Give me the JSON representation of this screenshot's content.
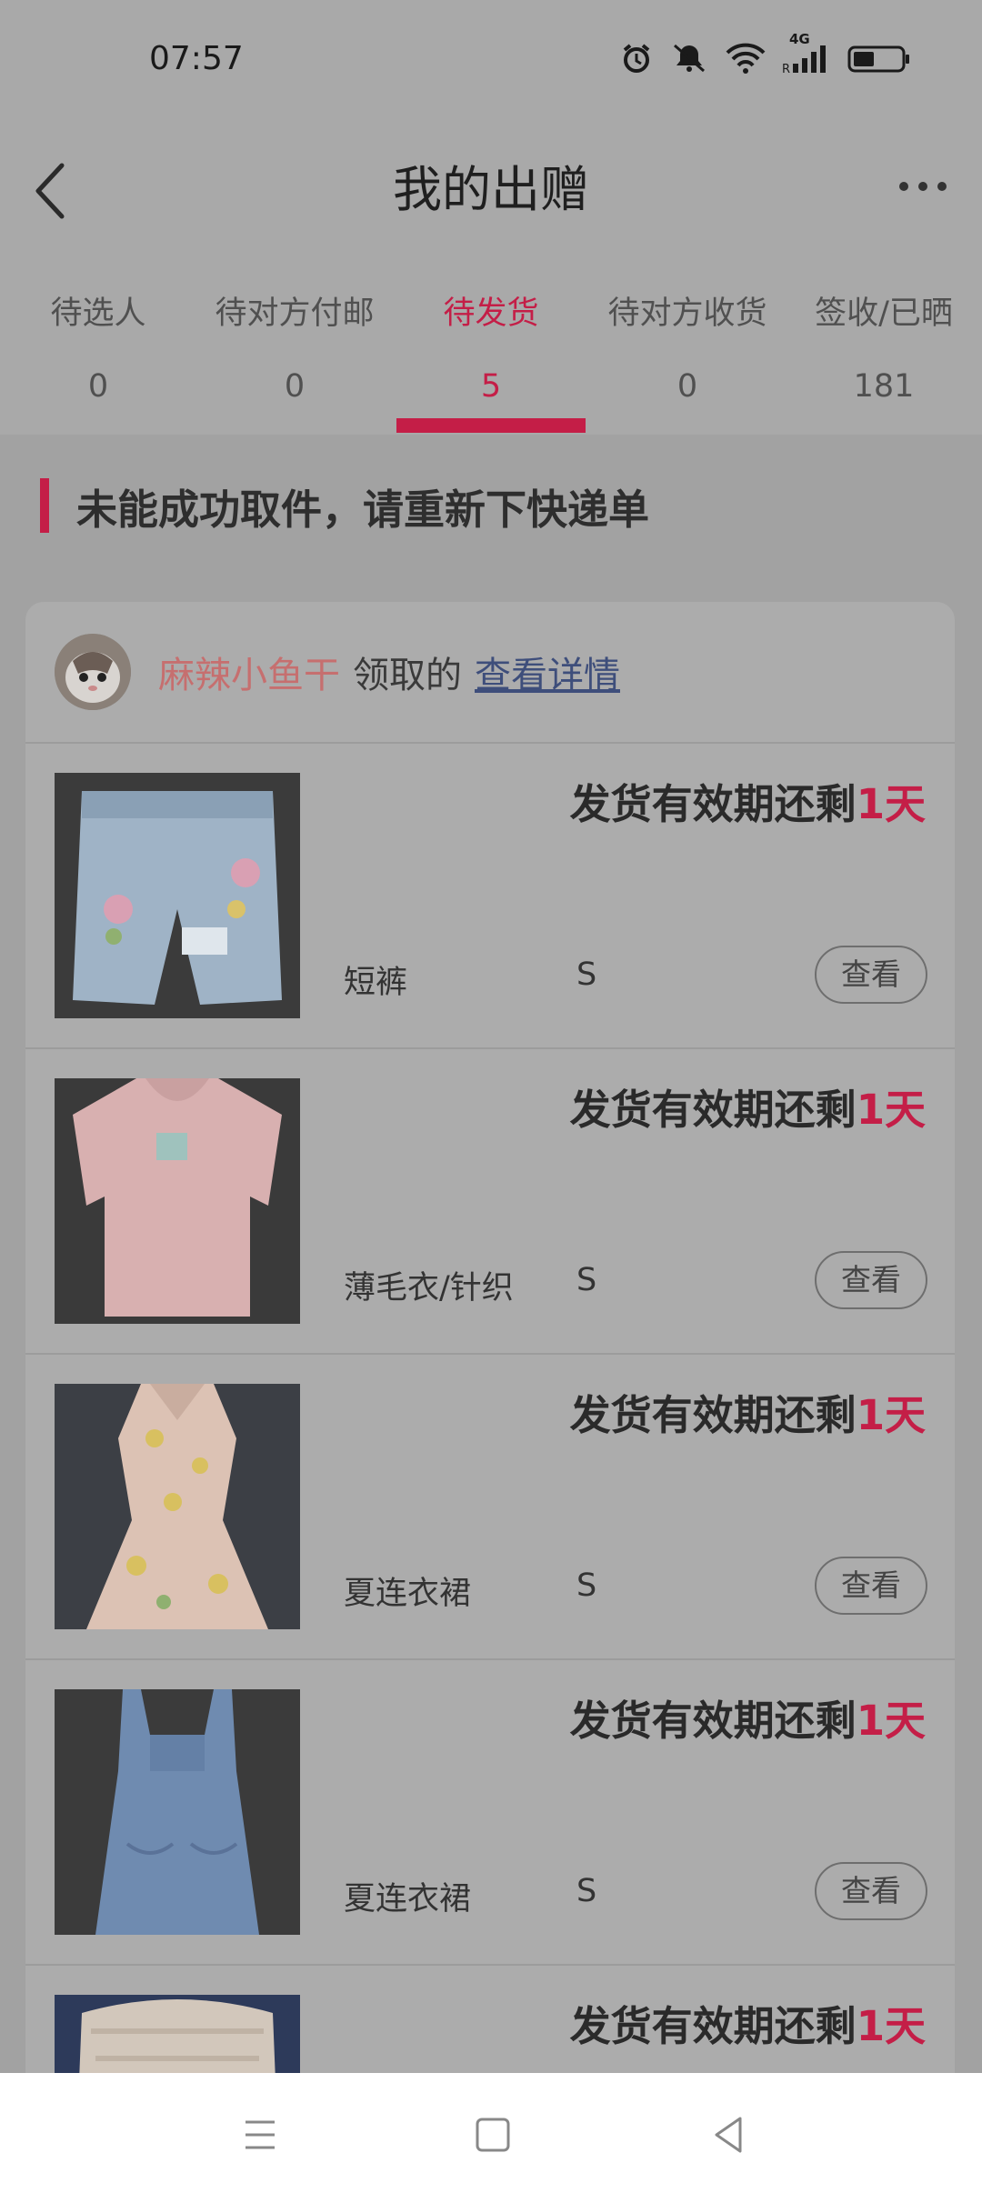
{
  "status": {
    "time": "07:57",
    "network": "4G"
  },
  "header": {
    "title": "我的出赠"
  },
  "tabs": [
    {
      "label": "待选人",
      "count": "0"
    },
    {
      "label": "待对方付邮",
      "count": "0"
    },
    {
      "label": "待发货",
      "count": "5"
    },
    {
      "label": "待对方收货",
      "count": "0"
    },
    {
      "label": "签收/已晒",
      "count": "181"
    }
  ],
  "active_tab_index": 2,
  "notice": "未能成功取件，请重新下快递单",
  "receiver": {
    "name": "麻辣小鱼干",
    "suffix": "领取的",
    "detail_link": "查看详情"
  },
  "items": [
    {
      "deadline_prefix": "发货有效期还剩",
      "deadline_days": "1天",
      "name": "短裤",
      "size": "S",
      "button": "查看"
    },
    {
      "deadline_prefix": "发货有效期还剩",
      "deadline_days": "1天",
      "name": "薄毛衣/针织",
      "size": "S",
      "button": "查看"
    },
    {
      "deadline_prefix": "发货有效期还剩",
      "deadline_days": "1天",
      "name": "夏连衣裙",
      "size": "S",
      "button": "查看"
    },
    {
      "deadline_prefix": "发货有效期还剩",
      "deadline_days": "1天",
      "name": "夏连衣裙",
      "size": "S",
      "button": "查看"
    },
    {
      "deadline_prefix": "发货有效期还剩",
      "deadline_days": "1天",
      "name": "",
      "size": "",
      "button": ""
    }
  ],
  "colors": {
    "accent": "#c41e47",
    "receiver_name": "#c66f6f",
    "link": "#3e4e7b"
  }
}
